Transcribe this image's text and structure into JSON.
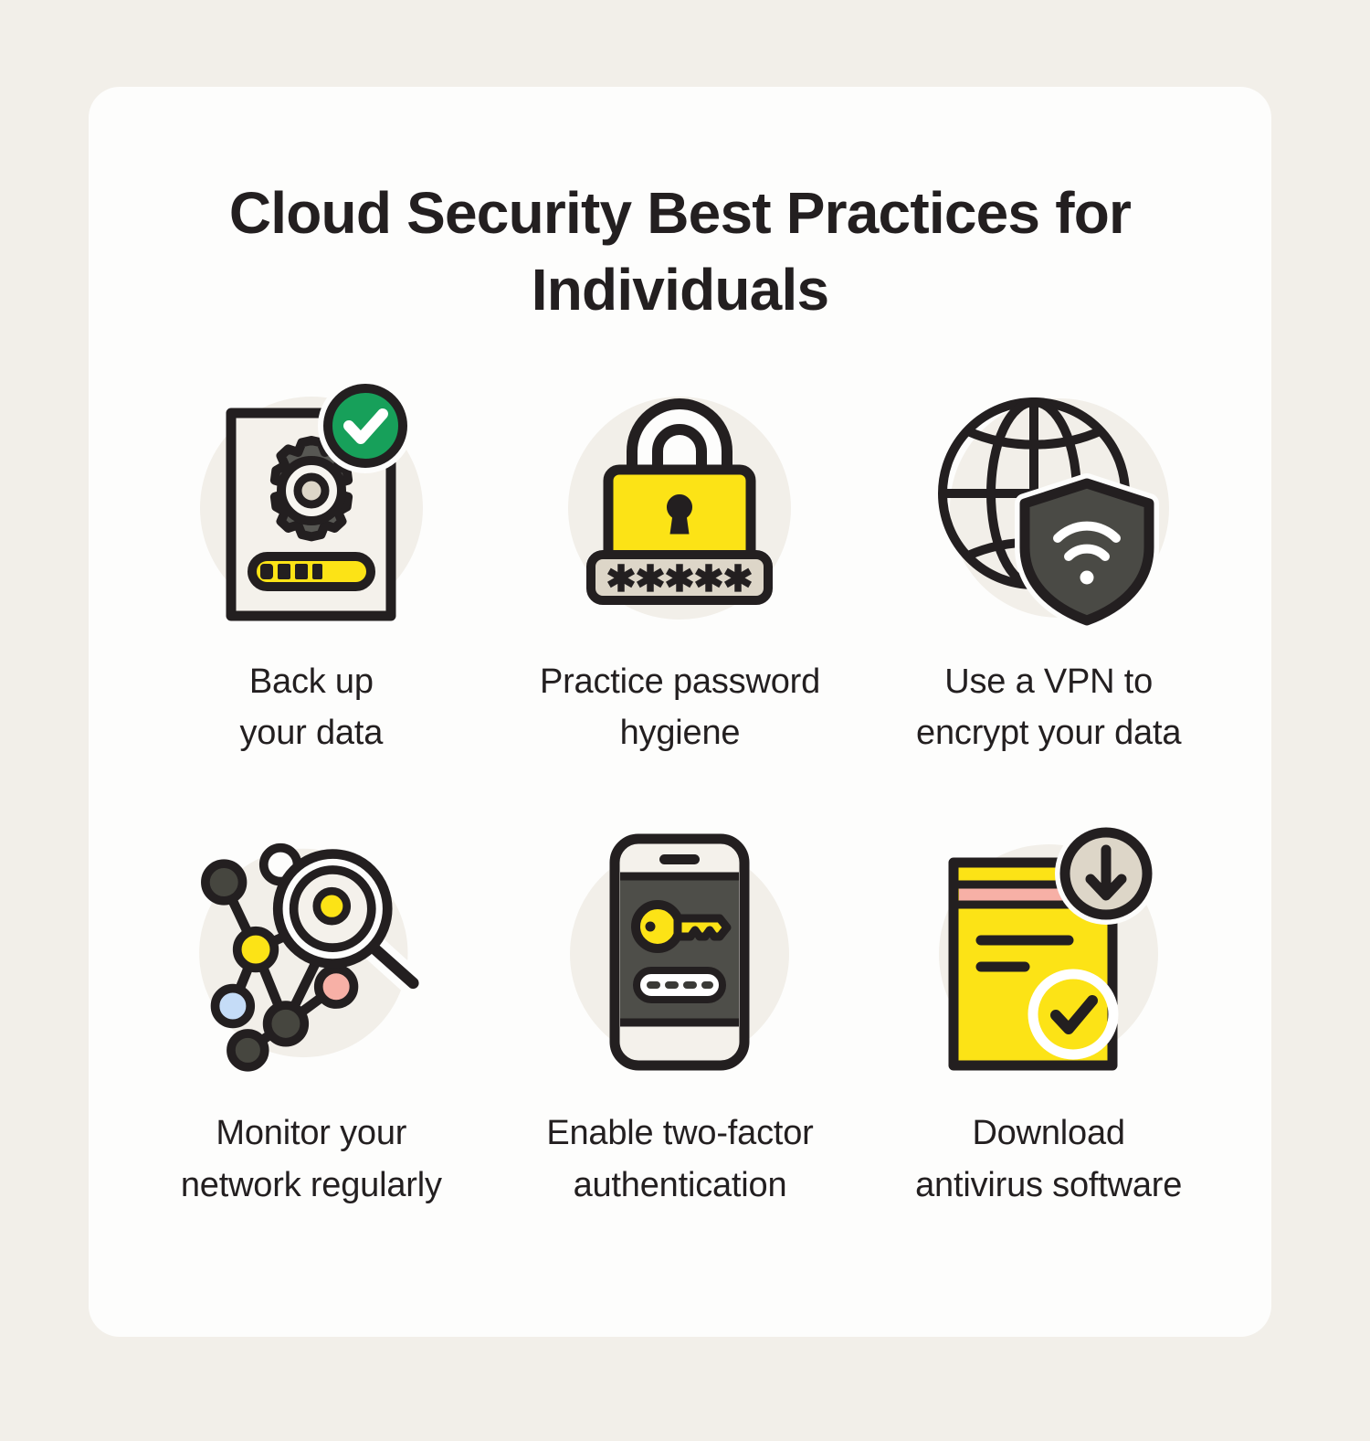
{
  "theme": {
    "page_background": "#f2efe9",
    "card_background": "#fdfdfc",
    "ink": "#231f20",
    "yellow": "#fce316",
    "green": "#17a05a",
    "gray_dark": "#4a4a45",
    "gray_mid": "#575753",
    "beige": "#ddd6c8",
    "circle_backdrop": "#f2efe9",
    "pink": "#f7b0a6",
    "blue": "#c5dcf7"
  },
  "header": {
    "title_line_1": "Cloud Security Best Practices",
    "title_line_2": "for Individuals",
    "title_full": "Cloud Security Best Practices for Individuals"
  },
  "practices": [
    {
      "id": "back-up-your-data",
      "caption": "Back up\nyour data",
      "icon_name": "document-gear-checkmark-icon",
      "icon_parts": [
        "document",
        "gear",
        "progress-bar",
        "green-check-badge"
      ],
      "progress_blocks": 4
    },
    {
      "id": "practice-password-hygiene",
      "caption": "Practice password\nhygiene",
      "icon_name": "padlock-password-icon",
      "icon_parts": [
        "padlock",
        "keyhole",
        "password-field"
      ],
      "password_mask": "✱✱✱✱✱",
      "password_dots": 5
    },
    {
      "id": "use-a-vpn-to-encrypt-your-data",
      "caption": "Use a VPN to\nencrypt your data",
      "icon_name": "globe-shield-wifi-icon",
      "icon_parts": [
        "globe",
        "shield",
        "wifi-signal"
      ]
    },
    {
      "id": "monitor-your-network-regularly",
      "caption": "Monitor your\nnetwork regularly",
      "icon_name": "network-graph-magnifier-icon",
      "icon_parts": [
        "network-nodes",
        "connection-lines",
        "magnifying-glass"
      ],
      "node_count": 8
    },
    {
      "id": "enable-two-factor-authentication",
      "caption": "Enable two-factor\nauthentication",
      "icon_name": "smartphone-key-passcode-icon",
      "icon_parts": [
        "smartphone",
        "key",
        "passcode-field"
      ],
      "passcode_dashes": 4
    },
    {
      "id": "download-antivirus-software",
      "caption": "Download\nantivirus software",
      "icon_name": "document-download-check-icon",
      "icon_parts": [
        "document",
        "download-badge",
        "check-circle",
        "text-lines"
      ]
    }
  ]
}
